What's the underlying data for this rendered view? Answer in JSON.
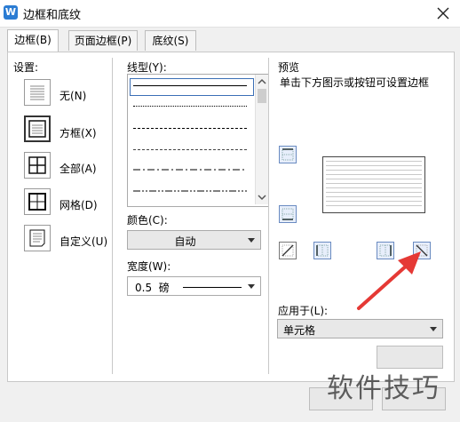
{
  "window": {
    "title": "边框和底纹"
  },
  "tabs": [
    {
      "label": "边框(B)"
    },
    {
      "label": "页面边框(P)"
    },
    {
      "label": "底纹(S)"
    }
  ],
  "settings": {
    "heading": "设置:",
    "items": [
      {
        "label": "无(N)"
      },
      {
        "label": "方框(X)",
        "selected": true
      },
      {
        "label": "全部(A)"
      },
      {
        "label": "网格(D)"
      },
      {
        "label": "自定义(U)"
      }
    ]
  },
  "style": {
    "heading": "线型(Y):",
    "line_styles": [
      "solid-thin",
      "dotted",
      "dashed",
      "dashed-short",
      "dash-dot",
      "dash-dot-dot"
    ],
    "color_label": "颜色(C):",
    "color_value": "自动",
    "width_label": "宽度(W):",
    "width_value": "0.5  磅"
  },
  "preview": {
    "heading": "预览",
    "hint": "单击下方图示或按钮可设置边框",
    "apply_label": "应用于(L):",
    "apply_value": "单元格"
  },
  "watermark": "软件技巧",
  "colors": {
    "accent": "#2b7cd3",
    "arrow": "#e53935"
  }
}
